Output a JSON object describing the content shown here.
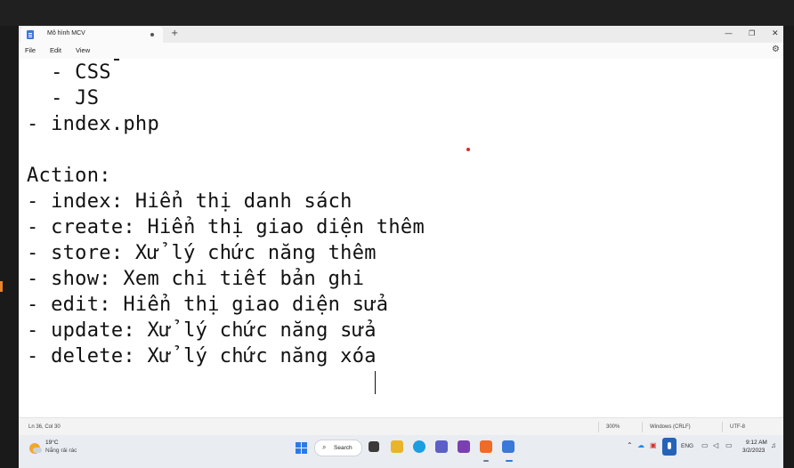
{
  "window": {
    "tab_title": "Mô hình MCV",
    "new_tab": "+",
    "minimize": "—",
    "restore": "❐",
    "close": "✕"
  },
  "menu": {
    "file": "File",
    "edit": "Edit",
    "view": "View"
  },
  "editor": {
    "lines": [
      "  - CSS",
      "  - JS",
      "- index.php",
      "",
      "Action:",
      "- index: Hiển thị danh sách",
      "- create: Hiển thị giao diện thêm",
      "- store: Xử lý chức năng thêm",
      "- show: Xem chi tiết bản ghi",
      "- edit: Hiển thị giao diện sửa",
      "- update: Xử lý chức năng sửa",
      "- delete: Xử lý chức năng xóa"
    ]
  },
  "status": {
    "position": "Ln 36, Col 30",
    "zoom": "300%",
    "line_ending": "Windows (CRLF)",
    "encoding": "UTF-8"
  },
  "taskbar": {
    "weather_temp": "19°C",
    "weather_desc": "Nắng rải rác",
    "search_label": "Search",
    "language": "ENG",
    "time": "9:12 AM",
    "date": "3/2/2023"
  },
  "colors": {
    "accent": "#2c7be5",
    "red_dot": "#e3262a"
  }
}
